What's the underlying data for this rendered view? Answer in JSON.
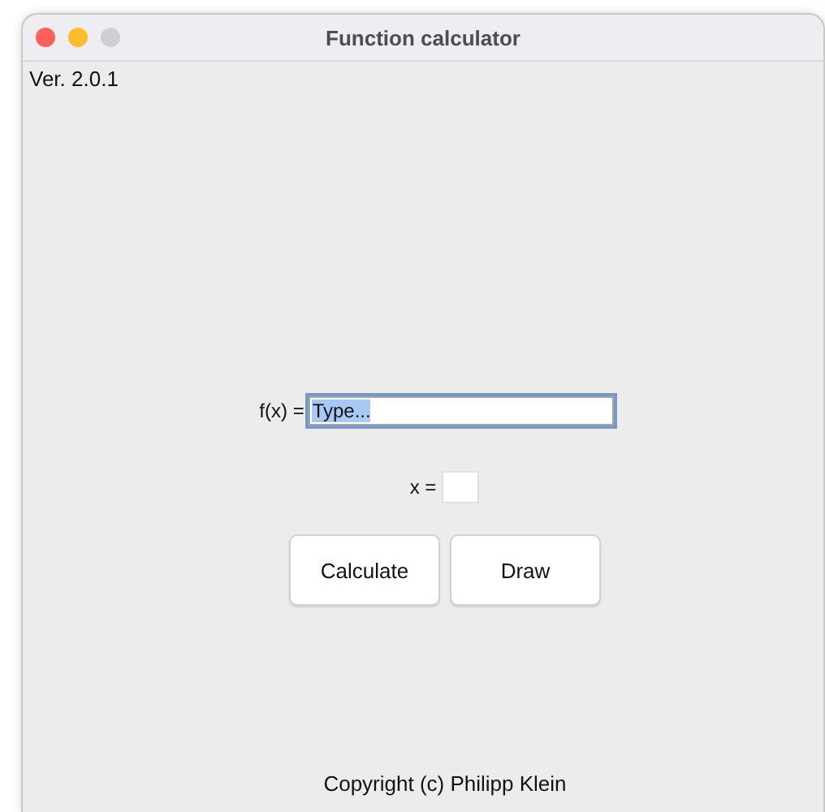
{
  "window": {
    "title": "Function calculator"
  },
  "version": "Ver. 2.0.1",
  "function_field": {
    "label": "f(x) =",
    "value": "Type...",
    "text_selected": true,
    "focused": true
  },
  "x_field": {
    "label": "x ="
  },
  "buttons": [
    {
      "label": "Calculate"
    },
    {
      "label": "Draw"
    }
  ],
  "footer": "Copyright (c) Philipp Klein"
}
